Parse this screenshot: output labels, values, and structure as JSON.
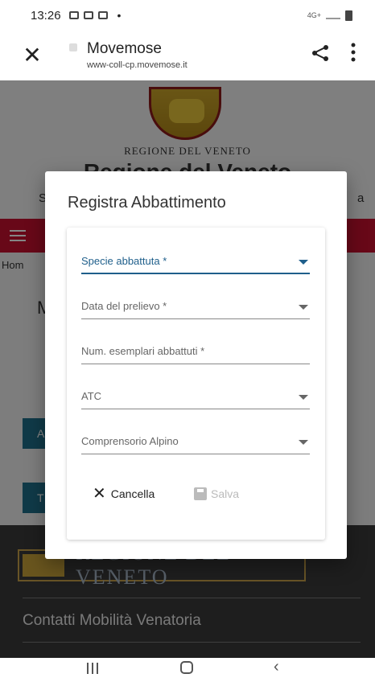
{
  "status_bar": {
    "time": "13:26",
    "dot": "•",
    "network": "4G+"
  },
  "browser": {
    "close_glyph": "✕",
    "title": "Movemose",
    "url": "www-coll-cp.movemose.it"
  },
  "background_page": {
    "header_small": "REGIONE DEL VENETO",
    "header_big": "Regione del Veneto",
    "left_partial": "S",
    "right_partial": "a",
    "breadcrumb": "Hom",
    "heading_partial": "M",
    "button_a": "A",
    "button_t": "T",
    "footer_logo_text": "REGIONE DEL VENETO",
    "footer_link": "Contatti Mobilità Venatoria"
  },
  "modal": {
    "title": "Registra Abbattimento",
    "fields": [
      {
        "label": "Specie abbattuta *",
        "type": "select",
        "active": true
      },
      {
        "label": "Data del prelievo *",
        "type": "select",
        "active": false
      },
      {
        "label": "Num. esemplari abbattuti *",
        "type": "text",
        "active": false
      },
      {
        "label": "ATC",
        "type": "select",
        "active": false
      },
      {
        "label": "Comprensorio Alpino",
        "type": "select",
        "active": false
      }
    ],
    "cancel_label": "Cancella",
    "save_label": "Salva"
  },
  "colors": {
    "accent": "#1f5f8b",
    "brand_red": "#c8102e",
    "teal": "#1f6f8b",
    "disabled": "#bbbbbb"
  },
  "icons": {
    "close": "close-icon",
    "share": "share-icon",
    "menu": "more-vert-icon",
    "dropdown": "chevron-down-icon",
    "cancel": "close-icon",
    "save": "save-disk-icon"
  }
}
